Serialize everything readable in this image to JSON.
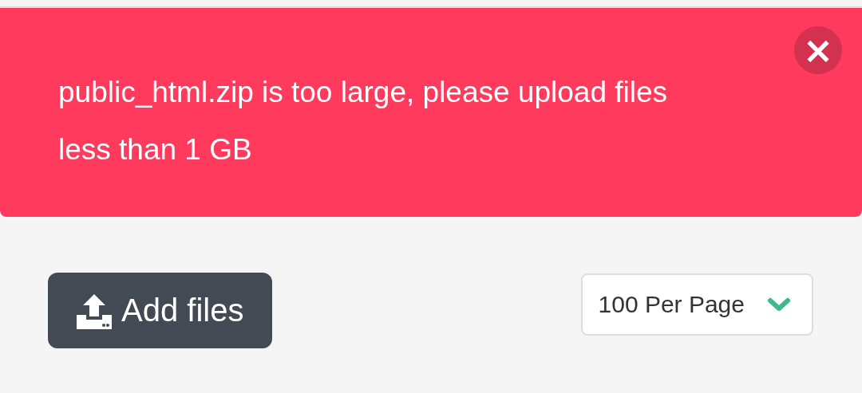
{
  "alert": {
    "message": "public_html.zip is too large, please upload files less than 1 GB",
    "close_label": "×"
  },
  "toolbar": {
    "add_button": "Add files",
    "per_page": {
      "value": "100 Per Page"
    }
  }
}
